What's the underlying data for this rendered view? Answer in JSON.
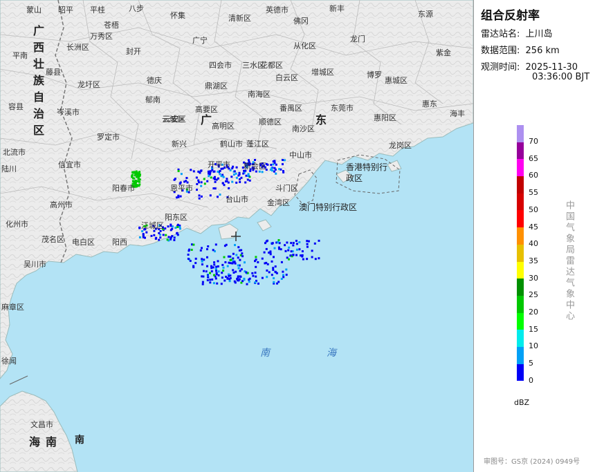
{
  "panel": {
    "title": "组合反射率",
    "station_label": "雷达站名:",
    "station_value": "上川岛",
    "range_label": "数据范围:",
    "range_value": "256 km",
    "time_label": "观测时间:",
    "time_date": "2025-11-30",
    "time_clock": "03:36:00 BJT",
    "legend_unit": "dBZ",
    "legend_ticks": [
      "70",
      "65",
      "60",
      "55",
      "50",
      "45",
      "40",
      "35",
      "30",
      "25",
      "20",
      "15",
      "10",
      "5",
      "0"
    ],
    "legend_colors": [
      "#ad90f0",
      "#96009b",
      "#ff00f0",
      "#c10000",
      "#d60000",
      "#ff0000",
      "#ff9000",
      "#e7c000",
      "#ffff00",
      "#009000",
      "#00c800",
      "#00ff00",
      "#00ecec",
      "#01a0f6",
      "#0000f6"
    ],
    "side_text": "中国气象局雷达气象中心",
    "approval": "审图号：GS京 (2024) 0949号"
  },
  "map": {
    "province_labels": [
      "广西壮族自治区",
      "广东",
      "海南"
    ],
    "sea_labels": [
      "南",
      "海"
    ],
    "region_labels": [
      "香港特别行政区",
      "澳门特别行政区"
    ],
    "places": [
      "蒙山",
      "昭平",
      "平桂",
      "八步",
      "怀集",
      "清新区",
      "英德市",
      "新丰",
      "东源",
      "苍梧",
      "万秀区",
      "长洲区",
      "封开",
      "广宁",
      "佛冈",
      "从化区",
      "龙门",
      "紫金",
      "平南",
      "藤县",
      "龙圩区",
      "四会市",
      "三水区",
      "花都区",
      "增城区",
      "博罗",
      "惠城区",
      "容县",
      "德庆",
      "鼎湖区",
      "南海区",
      "白云区",
      "惠东",
      "海丰",
      "岑溪市",
      "郁南",
      "云安区",
      "高要区",
      "番禺区",
      "东莞市",
      "惠阳区",
      "北流市",
      "罗定市",
      "云城区",
      "高明区",
      "顺德区",
      "南沙区",
      "龙岗区",
      "新兴",
      "鹤山市",
      "蓬江区",
      "中山市",
      "陆川",
      "信宜市",
      "开平市",
      "新会区",
      "阳春市",
      "恩平市",
      "台山市",
      "斗门区",
      "金湾区",
      "高州市",
      "阳东区",
      "江城区",
      "化州市",
      "茂名区",
      "电白区",
      "阳西",
      "吴川市",
      "麻章区",
      "徐闻",
      "文昌市"
    ]
  }
}
